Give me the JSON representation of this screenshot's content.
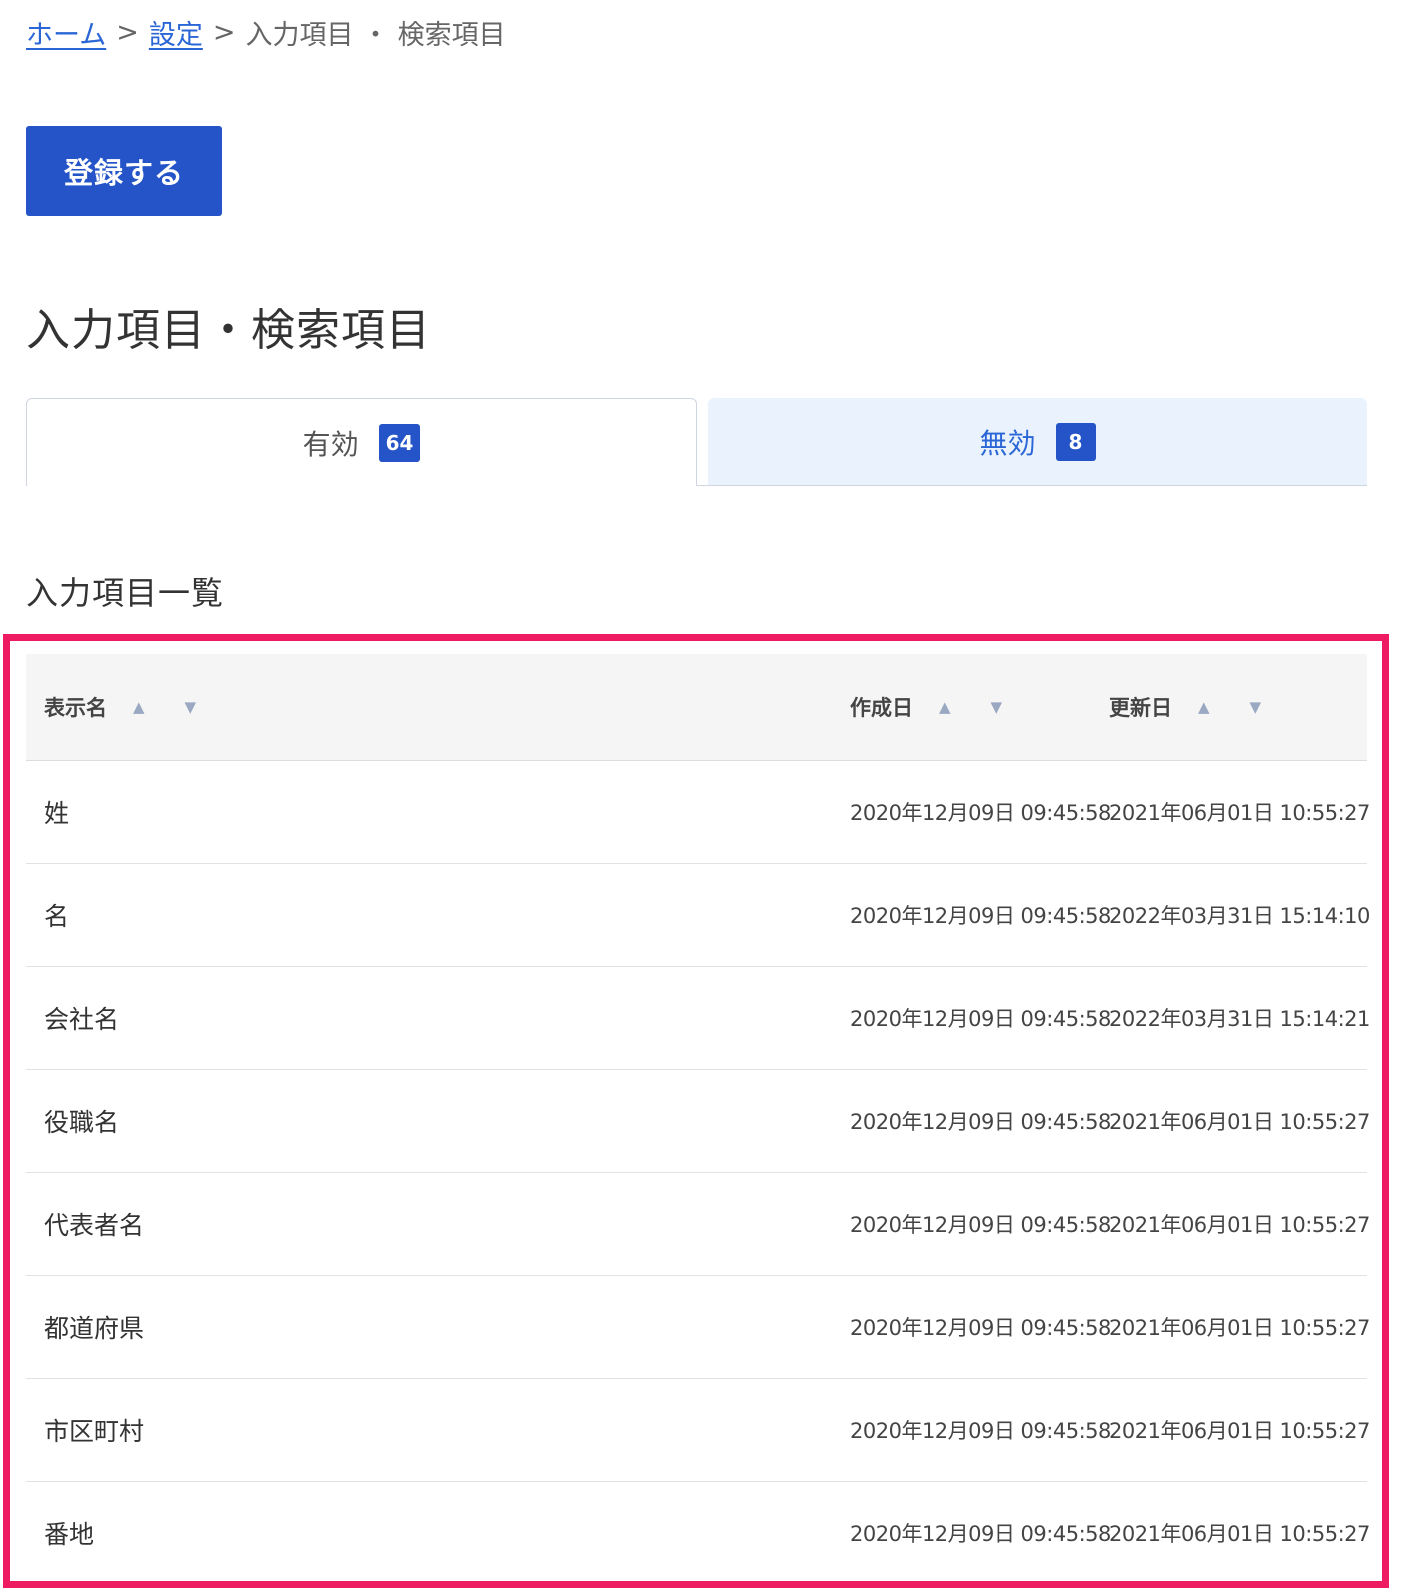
{
  "breadcrumb": {
    "home": "ホーム",
    "settings": "設定",
    "current": "入力項目 ・ 検索項目",
    "separator": ">"
  },
  "register_button": "登録する",
  "page_title": "入力項目・検索項目",
  "tabs": [
    {
      "label": "有効",
      "count": "64"
    },
    {
      "label": "無効",
      "count": "8"
    }
  ],
  "list_title": "入力項目一覧",
  "table": {
    "columns": [
      {
        "label": "表示名"
      },
      {
        "label": "作成日"
      },
      {
        "label": "更新日"
      }
    ],
    "sort_up_icon": "▲",
    "sort_down_icon": "▼",
    "rows": [
      {
        "name": "姓",
        "created": "2020年12月09日 09:45:58",
        "updated": "2021年06月01日 10:55:27"
      },
      {
        "name": "名",
        "created": "2020年12月09日 09:45:58",
        "updated": "2022年03月31日 15:14:10"
      },
      {
        "name": "会社名",
        "created": "2020年12月09日 09:45:58",
        "updated": "2022年03月31日 15:14:21"
      },
      {
        "name": "役職名",
        "created": "2020年12月09日 09:45:58",
        "updated": "2021年06月01日 10:55:27"
      },
      {
        "name": "代表者名",
        "created": "2020年12月09日 09:45:58",
        "updated": "2021年06月01日 10:55:27"
      },
      {
        "name": "都道府県",
        "created": "2020年12月09日 09:45:58",
        "updated": "2021年06月01日 10:55:27"
      },
      {
        "name": "市区町村",
        "created": "2020年12月09日 09:45:58",
        "updated": "2021年06月01日 10:55:27"
      },
      {
        "name": "番地",
        "created": "2020年12月09日 09:45:58",
        "updated": "2021年06月01日 10:55:27"
      }
    ]
  },
  "colors": {
    "primary": "#2454c8",
    "link": "#2b66d6",
    "highlight": "#ee1b63",
    "inactive_tab_bg": "#eaf3fd"
  }
}
